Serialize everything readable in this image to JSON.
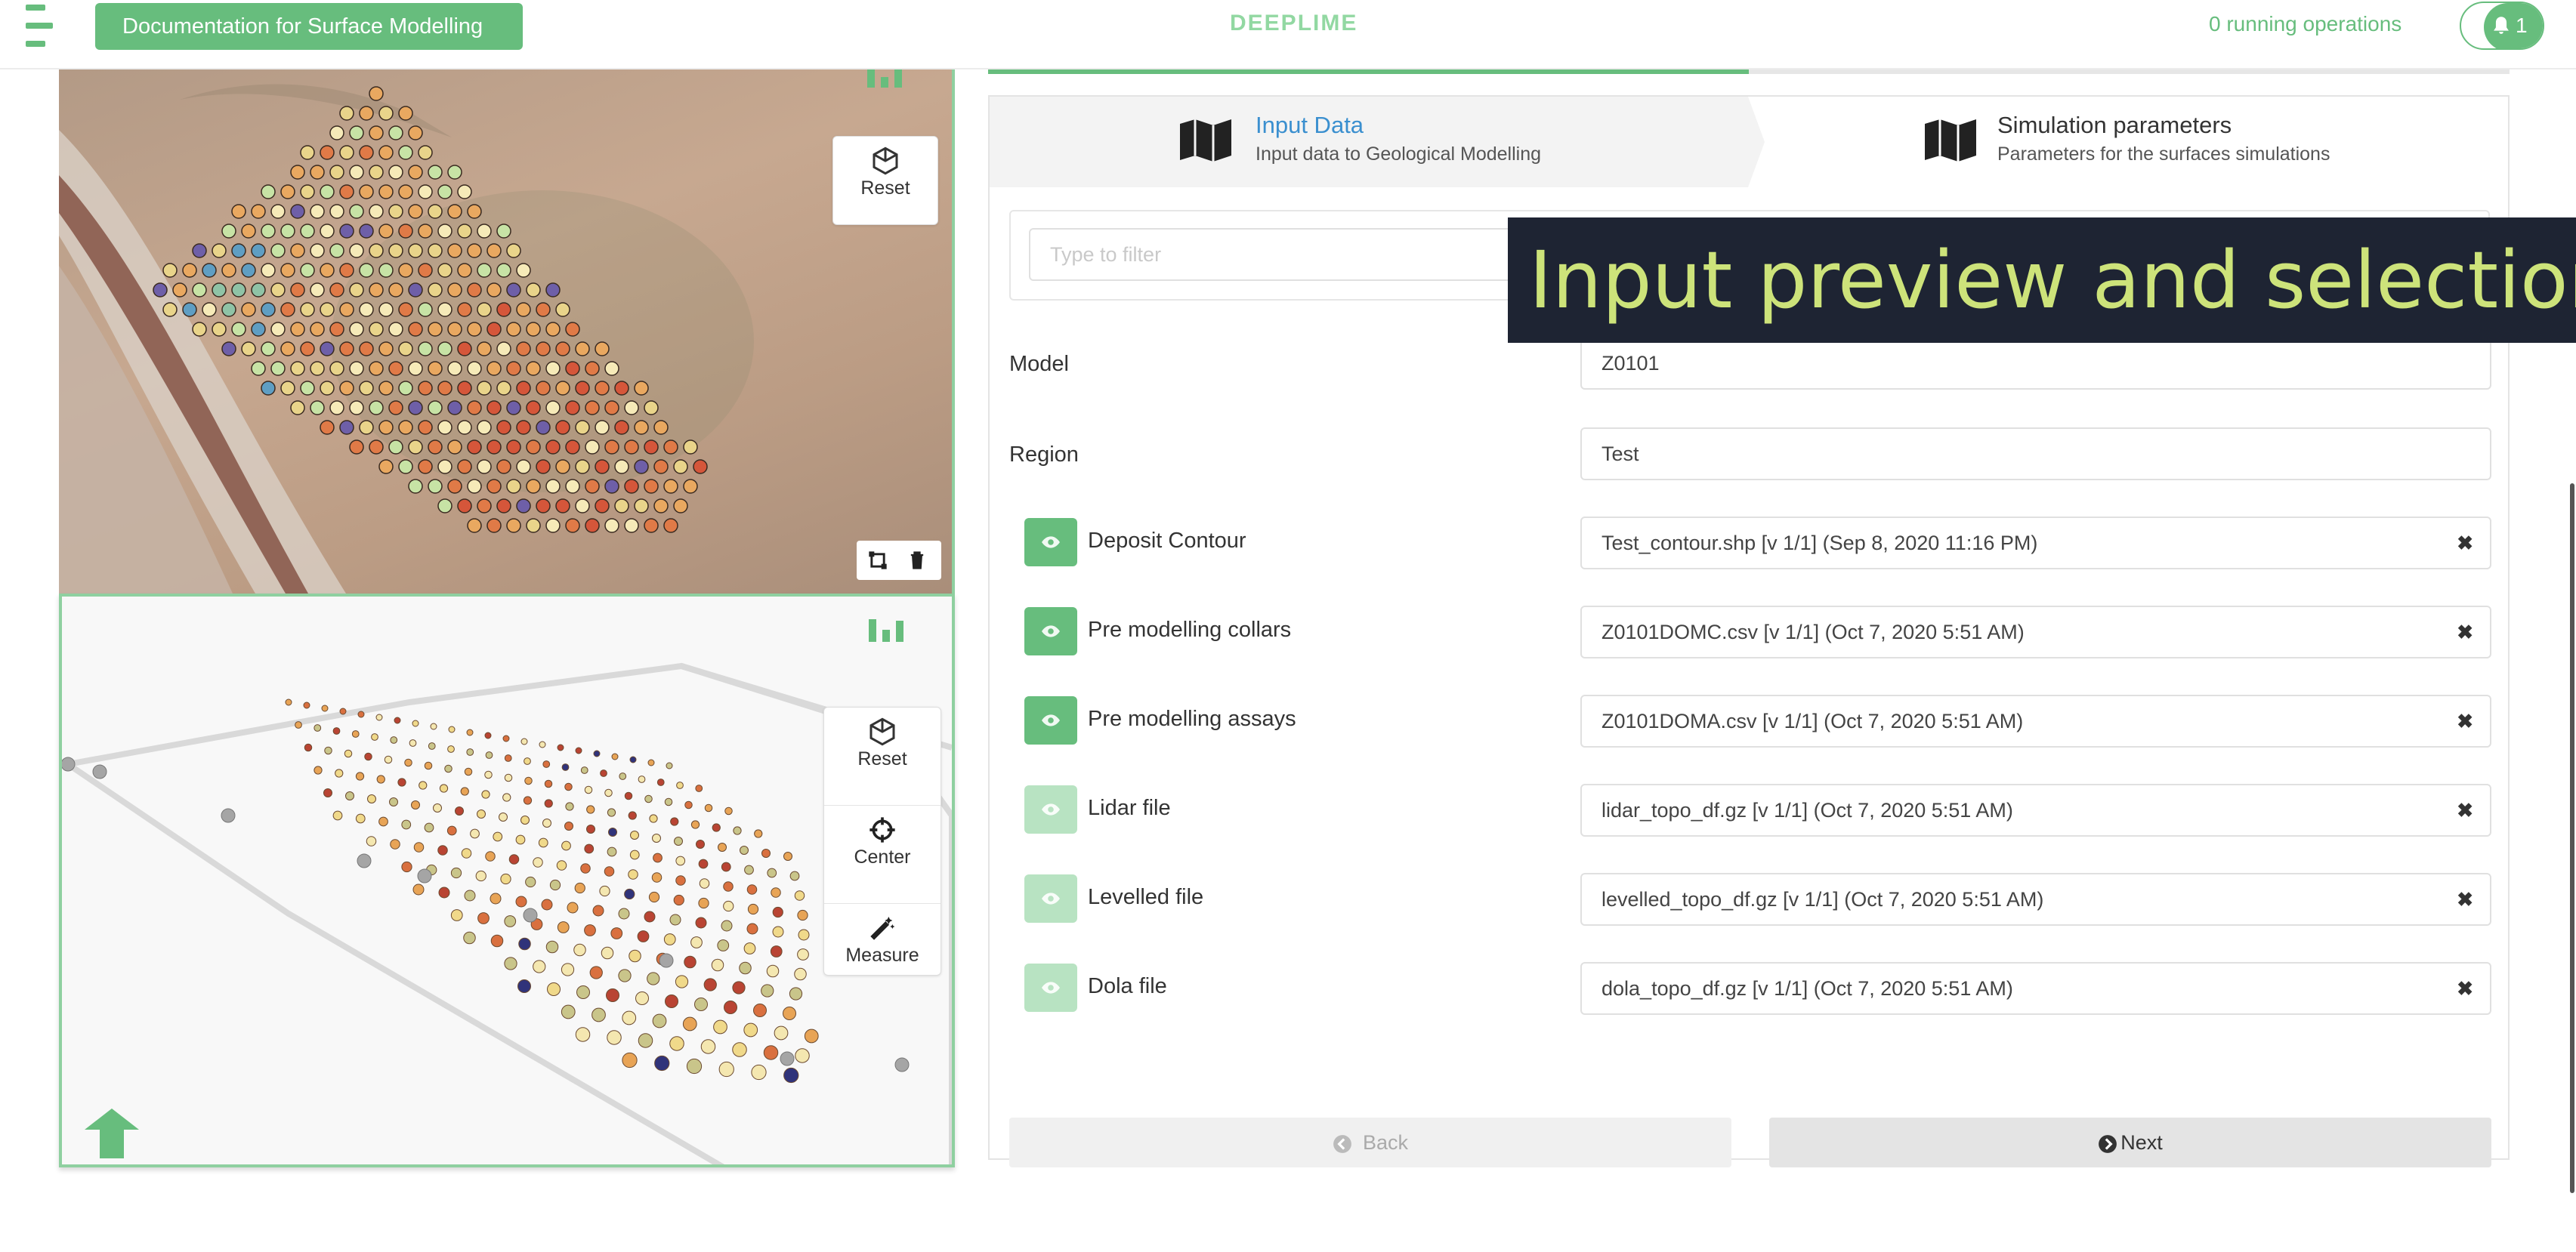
{
  "header": {
    "doc_button": "Documentation for Surface Modelling",
    "brand": "DEEPLIME",
    "running_ops": "0 running operations",
    "notification_count": "1"
  },
  "map_top": {
    "reset_label": "Reset"
  },
  "map_bottom": {
    "reset_label": "Reset",
    "center_label": "Center",
    "measure_label": "Measure"
  },
  "steps": [
    {
      "title": "Input Data",
      "subtitle": "Input data to Geological Modelling"
    },
    {
      "title": "Simulation parameters",
      "subtitle": "Parameters for the surfaces simulations"
    }
  ],
  "progress": 0.5,
  "filter": {
    "placeholder": "Type to filter"
  },
  "model": {
    "label": "Model",
    "value": "Z0101"
  },
  "region": {
    "label": "Region",
    "value": "Test"
  },
  "inputs": [
    {
      "label": "Deposit Contour",
      "value": "Test_contour.shp [v 1/1] (Sep 8, 2020 11:16 PM)",
      "visible": true
    },
    {
      "label": "Pre modelling collars",
      "value": "Z0101DOMC.csv [v 1/1] (Oct 7, 2020 5:51 AM)",
      "visible": true
    },
    {
      "label": "Pre modelling assays",
      "value": "Z0101DOMA.csv [v 1/1] (Oct 7, 2020 5:51 AM)",
      "visible": true
    },
    {
      "label": "Lidar file",
      "value": "lidar_topo_df.gz [v 1/1] (Oct 7, 2020 5:51 AM)",
      "visible": false
    },
    {
      "label": "Levelled file",
      "value": "levelled_topo_df.gz [v 1/1] (Oct 7, 2020 5:51 AM)",
      "visible": false
    },
    {
      "label": "Dola file",
      "value": "dola_topo_df.gz [v 1/1] (Oct 7, 2020 5:51 AM)",
      "visible": false
    }
  ],
  "buttons": {
    "back": "Back",
    "next": "Next"
  },
  "caption": "Input preview and selection",
  "colors": {
    "accent": "#67bd7d",
    "caption_bg": "#1e2433",
    "caption_text": "#cde37a"
  }
}
